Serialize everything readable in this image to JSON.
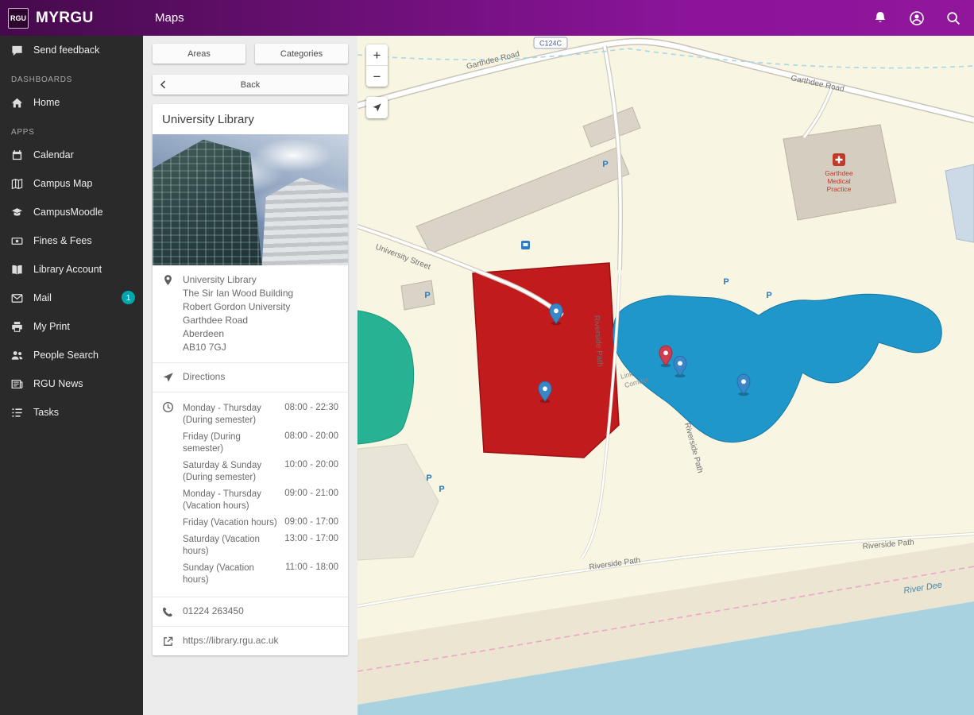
{
  "topbar": {
    "logo": "RGU",
    "app_name": "MYRGU",
    "page_title": "Maps"
  },
  "sidebar": {
    "feedback_label": "Send feedback",
    "dashboards_header": "DASHBOARDS",
    "home_label": "Home",
    "apps_header": "APPS",
    "mail_badge": "1",
    "apps": [
      {
        "label": "Calendar"
      },
      {
        "label": "Campus Map"
      },
      {
        "label": "CampusMoodle"
      },
      {
        "label": "Fines & Fees"
      },
      {
        "label": "Library Account"
      },
      {
        "label": "Mail"
      },
      {
        "label": "My Print"
      },
      {
        "label": "People Search"
      },
      {
        "label": "RGU News"
      },
      {
        "label": "Tasks"
      }
    ]
  },
  "panel": {
    "areas_label": "Areas",
    "categories_label": "Categories",
    "back_label": "Back",
    "place": {
      "title": "University Library",
      "address": [
        "University Library",
        "The Sir Ian Wood Building",
        "Robert Gordon University",
        "Garthdee Road",
        "Aberdeen",
        "AB10 7GJ"
      ],
      "directions_label": "Directions",
      "hours": [
        {
          "label": "Monday - Thursday (During semester)",
          "time": "08:00 - 22:30"
        },
        {
          "label": "Friday (During semester)",
          "time": "08:00 - 20:00"
        },
        {
          "label": "Saturday & Sunday (During semester)",
          "time": "10:00 - 20:00"
        },
        {
          "label": "Monday - Thursday (Vacation hours)",
          "time": "09:00 - 21:00"
        },
        {
          "label": "Friday (Vacation hours)",
          "time": "09:00 - 17:00"
        },
        {
          "label": "Saturday (Vacation hours)",
          "time": "13:00 - 17:00"
        },
        {
          "label": "Sunday (Vacation hours)",
          "time": "11:00 - 18:00"
        }
      ],
      "phone": "01224 263450",
      "website": "https://library.rgu.ac.uk"
    }
  },
  "map": {
    "zoom_in": "+",
    "zoom_out": "−",
    "road_ref": "C124C",
    "labels": {
      "garthdee_top": "Garthdee Road",
      "garthdee_right": "Garthdee Road",
      "university_street": "University Street",
      "riverside_1": "Riverside Path",
      "riverside_2": "Riverside Path",
      "riverside_3": "Riverside Path",
      "riverside_4": "Riverside Path",
      "river_dee": "River Dee",
      "link_1": "Link",
      "link_2": "Corridor",
      "medical_1": "Garthdee",
      "medical_2": "Medical",
      "medical_3": "Practice",
      "parking": "P"
    },
    "colors": {
      "selected_building": "#c21b1e",
      "highlight_area": "#1f97ca",
      "secondary_area": "#26b293",
      "water": "#a8d2df"
    }
  },
  "colors": {
    "topbar_gradient_start": "#450a4b",
    "topbar_gradient_end": "#91169c",
    "sidebar_bg": "#2a2a2a",
    "badge": "#00a6ae"
  }
}
